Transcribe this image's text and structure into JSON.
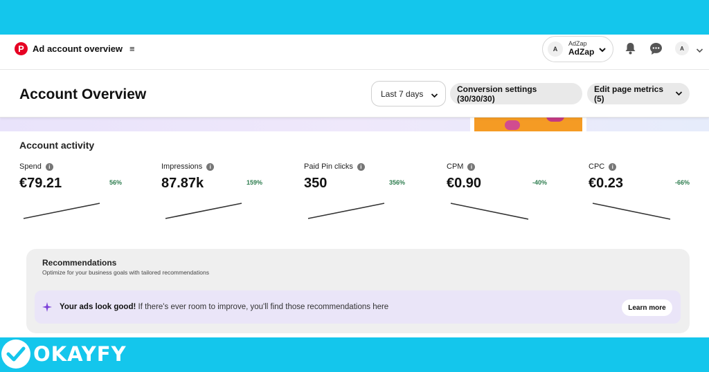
{
  "brand": {
    "name": "OKAYFY"
  },
  "nav": {
    "title": "Ad account overview",
    "account": {
      "avatar": "A",
      "small": "AdZap",
      "name": "AdZap"
    },
    "user_avatar": "A",
    "icons": [
      "bell-icon",
      "chat-icon"
    ]
  },
  "header": {
    "title": "Account Overview",
    "date_range": "Last 7 days",
    "conversion_settings": "Conversion settings (30/30/30)",
    "edit_metrics": "Edit page metrics (5)"
  },
  "activity": {
    "title": "Account activity",
    "metrics": [
      {
        "label": "Spend",
        "value": "€79.21",
        "change": "56%",
        "trend": "up"
      },
      {
        "label": "Impressions",
        "value": "87.87k",
        "change": "159%",
        "trend": "up"
      },
      {
        "label": "Paid Pin clicks",
        "value": "350",
        "change": "356%",
        "trend": "up"
      },
      {
        "label": "CPM",
        "value": "€0.90",
        "change": "-40%",
        "trend": "down"
      },
      {
        "label": "CPC",
        "value": "€0.23",
        "change": "-66%",
        "trend": "down"
      }
    ]
  },
  "recommendations": {
    "title": "Recommendations",
    "subtitle": "Optimize for your business goals with tailored recommendations",
    "card_bold": "Your ads look good!",
    "card_text": " If there's ever room to improve, you'll find those recommendations here",
    "learn_more": "Learn more"
  },
  "colors": {
    "frame": "#14c6ec",
    "pinterest_red": "#e60023",
    "positive_change": "#2e7d4f"
  }
}
